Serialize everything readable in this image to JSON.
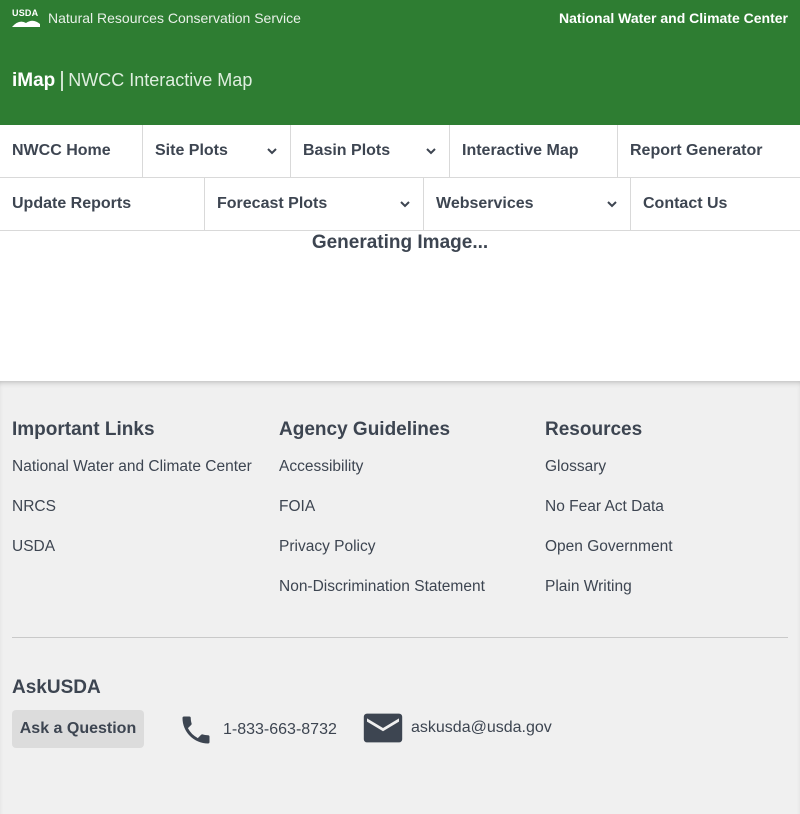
{
  "topbar": {
    "logo_text": "USDA",
    "agency": "Natural Resources Conservation Service",
    "center": "National Water and Climate Center"
  },
  "header": {
    "brand": "iMap",
    "subtitle": "NWCC Interactive Map"
  },
  "nav": {
    "row1": [
      {
        "label": "NWCC Home",
        "dropdown": false
      },
      {
        "label": "Site Plots",
        "dropdown": true
      },
      {
        "label": "Basin Plots",
        "dropdown": true
      },
      {
        "label": "Interactive Map",
        "dropdown": false
      },
      {
        "label": "Report Generator",
        "dropdown": false
      }
    ],
    "row2": [
      {
        "label": "Update Reports",
        "dropdown": false
      },
      {
        "label": "Forecast Plots",
        "dropdown": true
      },
      {
        "label": "Webservices",
        "dropdown": true
      },
      {
        "label": "Contact Us",
        "dropdown": false
      }
    ]
  },
  "main": {
    "status": "Generating Image..."
  },
  "footer": {
    "important_links": {
      "title": "Important Links",
      "items": [
        "National Water and Climate Center",
        "NRCS",
        "USDA"
      ]
    },
    "agency_guidelines": {
      "title": "Agency Guidelines",
      "items": [
        "Accessibility",
        "FOIA",
        "Privacy Policy",
        "Non-Discrimination Statement"
      ]
    },
    "resources": {
      "title": "Resources",
      "items": [
        "Glossary",
        "No Fear Act Data",
        "Open Government",
        "Plain Writing"
      ]
    },
    "askusda": {
      "title": "AskUSDA",
      "button": "Ask a Question",
      "phone": "1-833-663-8732",
      "email": "askusda@usda.gov"
    }
  },
  "colors": {
    "brand_green": "#2e7d32",
    "footer_bg": "#f0f0f0",
    "text": "#3d4551"
  }
}
